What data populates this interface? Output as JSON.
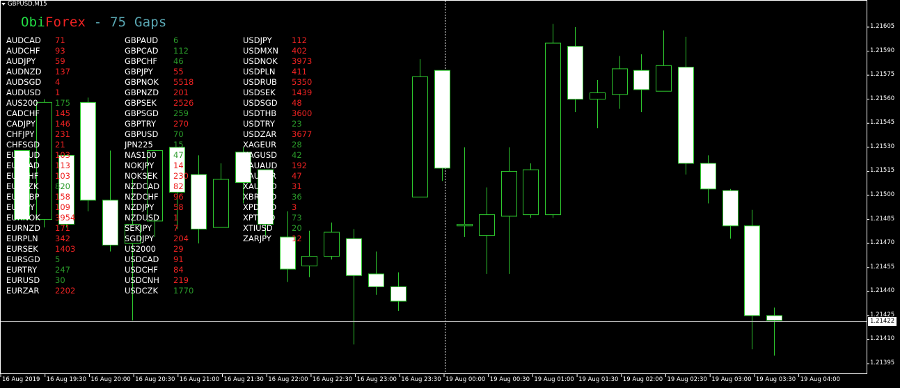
{
  "window": {
    "title": "GBPUSD,M15"
  },
  "indicator": {
    "parts": [
      {
        "text": "Obi",
        "color": "#22dd44"
      },
      {
        "text": "Forex",
        "color": "#ee2222"
      },
      {
        "text": " - 75 Gaps",
        "color": "#5aa8b4"
      }
    ]
  },
  "colors": {
    "background": "#000000",
    "candle_outline": "#2ec82e",
    "candle_bull_fill": "#000000",
    "candle_bear_fill": "#ffffff",
    "gap_red": "#ee2222",
    "gap_green": "#2a9a2a",
    "axis": "#ffffff"
  },
  "gap_columns": [
    [
      {
        "symbol": "AUDCAD",
        "value": "71",
        "color": "red"
      },
      {
        "symbol": "AUDCHF",
        "value": "93",
        "color": "red"
      },
      {
        "symbol": "AUDJPY",
        "value": "59",
        "color": "red"
      },
      {
        "symbol": "AUDNZD",
        "value": "137",
        "color": "red"
      },
      {
        "symbol": "AUDSGD",
        "value": "4",
        "color": "red"
      },
      {
        "symbol": "AUDUSD",
        "value": "1",
        "color": "red"
      },
      {
        "symbol": "AUS200",
        "value": "175",
        "color": "green"
      },
      {
        "symbol": "CADCHF",
        "value": "145",
        "color": "red"
      },
      {
        "symbol": "CADJPY",
        "value": "146",
        "color": "red"
      },
      {
        "symbol": "CHFJPY",
        "value": "231",
        "color": "red"
      },
      {
        "symbol": "CHFSGD",
        "value": "21",
        "color": "red"
      },
      {
        "symbol": "EURAUD",
        "value": "103",
        "color": "red"
      },
      {
        "symbol": "EURCAD",
        "value": "113",
        "color": "red"
      },
      {
        "symbol": "EURCHF",
        "value": "103",
        "color": "red"
      },
      {
        "symbol": "EURCZK",
        "value": "820",
        "color": "green"
      },
      {
        "symbol": "EURGBP",
        "value": "158",
        "color": "red"
      },
      {
        "symbol": "EURJPY",
        "value": "109",
        "color": "red"
      },
      {
        "symbol": "EURNOK",
        "value": "3954",
        "color": "red"
      },
      {
        "symbol": "EURNZD",
        "value": "171",
        "color": "red"
      },
      {
        "symbol": "EURPLN",
        "value": "342",
        "color": "red"
      },
      {
        "symbol": "EURSEK",
        "value": "1403",
        "color": "red"
      },
      {
        "symbol": "EURSGD",
        "value": "5",
        "color": "green"
      },
      {
        "symbol": "EURTRY",
        "value": "247",
        "color": "green"
      },
      {
        "symbol": "EURUSD",
        "value": "30",
        "color": "green"
      },
      {
        "symbol": "EURZAR",
        "value": "2202",
        "color": "red"
      }
    ],
    [
      {
        "symbol": "GBPAUD",
        "value": "6",
        "color": "green"
      },
      {
        "symbol": "GBPCAD",
        "value": "112",
        "color": "green"
      },
      {
        "symbol": "GBPCHF",
        "value": "46",
        "color": "green"
      },
      {
        "symbol": "GBPJPY",
        "value": "55",
        "color": "red"
      },
      {
        "symbol": "GBPNOK",
        "value": "5518",
        "color": "red"
      },
      {
        "symbol": "GBPNZD",
        "value": "201",
        "color": "red"
      },
      {
        "symbol": "GBPSEK",
        "value": "2526",
        "color": "red"
      },
      {
        "symbol": "GBPSGD",
        "value": "259",
        "color": "green"
      },
      {
        "symbol": "GBPTRY",
        "value": "270",
        "color": "red"
      },
      {
        "symbol": "GBPUSD",
        "value": "70",
        "color": "green"
      },
      {
        "symbol": "JPN225",
        "value": "15",
        "color": "green"
      },
      {
        "symbol": "NAS100",
        "value": "47",
        "color": "green"
      },
      {
        "symbol": "NOKJPY",
        "value": "14",
        "color": "red"
      },
      {
        "symbol": "NOKSEK",
        "value": "230",
        "color": "red"
      },
      {
        "symbol": "NZDCAD",
        "value": "82",
        "color": "red"
      },
      {
        "symbol": "NZDCHF",
        "value": "96",
        "color": "red"
      },
      {
        "symbol": "NZDJPY",
        "value": "58",
        "color": "red"
      },
      {
        "symbol": "NZDUSD",
        "value": "1",
        "color": "red"
      },
      {
        "symbol": "SEKJPY",
        "value": "7",
        "color": "red"
      },
      {
        "symbol": "SGDJPY",
        "value": "204",
        "color": "red"
      },
      {
        "symbol": "US2000",
        "value": "29",
        "color": "red"
      },
      {
        "symbol": "USDCAD",
        "value": "91",
        "color": "red"
      },
      {
        "symbol": "USDCHF",
        "value": "84",
        "color": "red"
      },
      {
        "symbol": "USDCNH",
        "value": "219",
        "color": "red"
      },
      {
        "symbol": "USDCZK",
        "value": "1770",
        "color": "green"
      }
    ],
    [
      {
        "symbol": "USDJPY",
        "value": "112",
        "color": "red"
      },
      {
        "symbol": "USDMXN",
        "value": "402",
        "color": "red"
      },
      {
        "symbol": "USDNOK",
        "value": "3973",
        "color": "red"
      },
      {
        "symbol": "USDPLN",
        "value": "411",
        "color": "red"
      },
      {
        "symbol": "USDRUB",
        "value": "5350",
        "color": "red"
      },
      {
        "symbol": "USDSEK",
        "value": "1439",
        "color": "red"
      },
      {
        "symbol": "USDSGD",
        "value": "48",
        "color": "red"
      },
      {
        "symbol": "USDTHB",
        "value": "3600",
        "color": "red"
      },
      {
        "symbol": "USDTRY",
        "value": "23",
        "color": "green"
      },
      {
        "symbol": "USDZAR",
        "value": "3677",
        "color": "red"
      },
      {
        "symbol": "XAGEUR",
        "value": "28",
        "color": "green"
      },
      {
        "symbol": "XAGUSD",
        "value": "42",
        "color": "green"
      },
      {
        "symbol": "XAUAUD",
        "value": "192",
        "color": "red"
      },
      {
        "symbol": "XAUEUR",
        "value": "47",
        "color": "red"
      },
      {
        "symbol": "XAUUSD",
        "value": "31",
        "color": "red"
      },
      {
        "symbol": "XBRUSD",
        "value": "36",
        "color": "green"
      },
      {
        "symbol": "XPDUSD",
        "value": "3",
        "color": "red"
      },
      {
        "symbol": "XPTUSD",
        "value": "73",
        "color": "green"
      },
      {
        "symbol": "XTIUSD",
        "value": "20",
        "color": "green"
      },
      {
        "symbol": "ZARJPY",
        "value": "12",
        "color": "red"
      }
    ]
  ],
  "current_price": "1.21422",
  "chart_data": {
    "type": "candlestick",
    "symbol": "GBPUSD",
    "timeframe": "M15",
    "ylim": [
      1.21388,
      1.21618
    ],
    "yticks": [
      "1.21605",
      "1.21590",
      "1.21575",
      "1.21560",
      "1.21545",
      "1.21530",
      "1.21515",
      "1.21500",
      "1.21485",
      "1.21470",
      "1.21455",
      "1.21440",
      "1.21425",
      "1.21410",
      "1.21395"
    ],
    "xticks": [
      "16 Aug 2019",
      "16 Aug 19:30",
      "16 Aug 20:00",
      "16 Aug 20:30",
      "16 Aug 21:00",
      "16 Aug 21:30",
      "16 Aug 22:00",
      "16 Aug 22:30",
      "16 Aug 23:00",
      "16 Aug 23:30",
      "19 Aug 00:00",
      "19 Aug 00:30",
      "19 Aug 01:00",
      "19 Aug 01:30",
      "19 Aug 02:00",
      "19 Aug 02:30",
      "19 Aug 03:00",
      "19 Aug 03:30",
      "19 Aug 04:00"
    ],
    "candles": [
      {
        "o": 1.21528,
        "h": 1.21528,
        "l": 1.21485,
        "c": 1.21485
      },
      {
        "o": 1.21485,
        "h": 1.2156,
        "l": 1.2148,
        "c": 1.21558
      },
      {
        "o": 1.21525,
        "h": 1.21525,
        "l": 1.2148,
        "c": 1.21482
      },
      {
        "o": 1.21558,
        "h": 1.21561,
        "l": 1.2149,
        "c": 1.21497
      },
      {
        "o": 1.21497,
        "h": 1.21528,
        "l": 1.21465,
        "c": 1.21469
      },
      {
        "o": 1.2147,
        "h": 1.2151,
        "l": 1.21422,
        "c": 1.21482
      },
      {
        "o": 1.21484,
        "h": 1.21495,
        "l": 1.21474,
        "c": 1.21528
      },
      {
        "o": 1.2153,
        "h": 1.215,
        "l": 1.21479,
        "c": 1.21502
      },
      {
        "o": 1.21513,
        "h": 1.21525,
        "l": 1.2147,
        "c": 1.21479
      },
      {
        "o": 1.2148,
        "h": 1.2152,
        "l": 1.2148,
        "c": 1.2151
      },
      {
        "o": 1.21527,
        "h": 1.2153,
        "l": 1.21495,
        "c": 1.21508
      },
      {
        "o": 1.21516,
        "h": 1.21497,
        "l": 1.21475,
        "c": 1.21482
      },
      {
        "o": 1.21474,
        "h": 1.2149,
        "l": 1.21446,
        "c": 1.21454
      },
      {
        "o": 1.21456,
        "h": 1.21478,
        "l": 1.21449,
        "c": 1.21462
      },
      {
        "o": 1.21462,
        "h": 1.21483,
        "l": 1.2146,
        "c": 1.21477
      },
      {
        "o": 1.21473,
        "h": 1.21479,
        "l": 1.21407,
        "c": 1.2145
      },
      {
        "o": 1.21451,
        "h": 1.21465,
        "l": 1.21438,
        "c": 1.21443
      },
      {
        "o": 1.21443,
        "h": 1.21452,
        "l": 1.21428,
        "c": 1.21434
      },
      {
        "o": 1.21499,
        "h": 1.21585,
        "l": 1.21499,
        "c": 1.21574
      },
      {
        "o": 1.21578,
        "h": 1.21578,
        "l": 1.21509,
        "c": 1.21517
      },
      {
        "o": 1.21481,
        "h": 1.2153,
        "l": 1.21474,
        "c": 1.21482
      },
      {
        "o": 1.21475,
        "h": 1.21505,
        "l": 1.21451,
        "c": 1.21488
      },
      {
        "o": 1.21487,
        "h": 1.2153,
        "l": 1.21451,
        "c": 1.21515
      },
      {
        "o": 1.21488,
        "h": 1.2152,
        "l": 1.21486,
        "c": 1.21516
      },
      {
        "o": 1.21488,
        "h": 1.21607,
        "l": 1.21486,
        "c": 1.21595
      },
      {
        "o": 1.21593,
        "h": 1.21605,
        "l": 1.21552,
        "c": 1.2156
      },
      {
        "o": 1.2156,
        "h": 1.21572,
        "l": 1.21542,
        "c": 1.21564
      },
      {
        "o": 1.21563,
        "h": 1.21587,
        "l": 1.21554,
        "c": 1.21579
      },
      {
        "o": 1.21578,
        "h": 1.21588,
        "l": 1.21552,
        "c": 1.21566
      },
      {
        "o": 1.21565,
        "h": 1.21603,
        "l": 1.21566,
        "c": 1.21581
      },
      {
        "o": 1.2158,
        "h": 1.21599,
        "l": 1.21513,
        "c": 1.2152
      },
      {
        "o": 1.2152,
        "h": 1.21525,
        "l": 1.21495,
        "c": 1.21504
      },
      {
        "o": 1.21503,
        "h": 1.21504,
        "l": 1.21473,
        "c": 1.21481
      },
      {
        "o": 1.21481,
        "h": 1.21491,
        "l": 1.21404,
        "c": 1.21425
      },
      {
        "o": 1.21425,
        "h": 1.2143,
        "l": 1.214,
        "c": 1.21422
      }
    ]
  }
}
